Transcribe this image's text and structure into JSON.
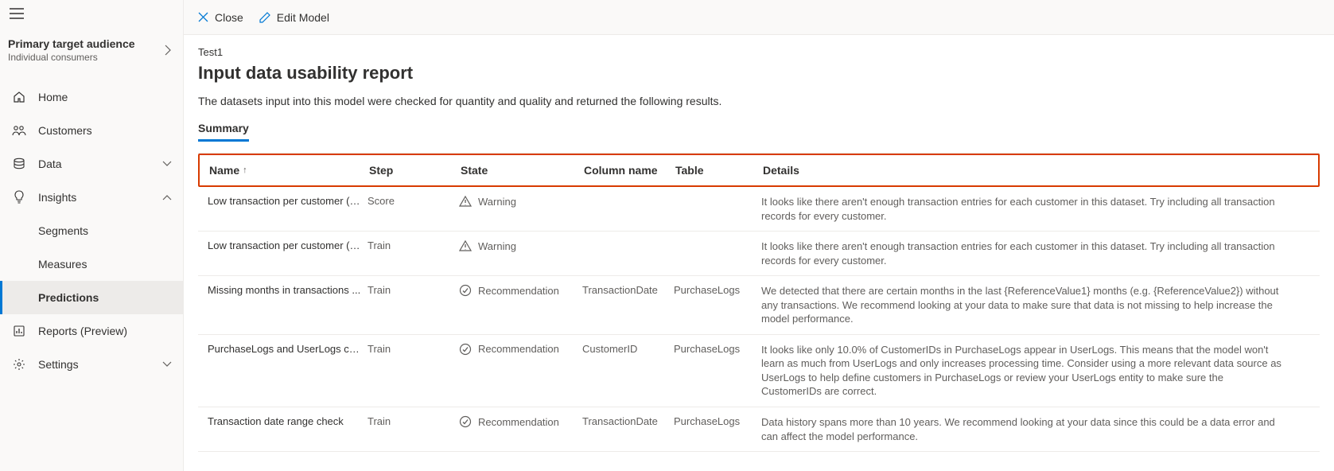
{
  "sidebar": {
    "title": "Primary target audience",
    "subtitle": "Individual consumers",
    "nav": {
      "home": "Home",
      "customers": "Customers",
      "data": "Data",
      "insights": "Insights",
      "segments": "Segments",
      "measures": "Measures",
      "predictions": "Predictions",
      "reports": "Reports (Preview)",
      "settings": "Settings"
    }
  },
  "toolbar": {
    "close": "Close",
    "edit_model": "Edit Model"
  },
  "page": {
    "breadcrumb": "Test1",
    "title": "Input data usability report",
    "description": "The datasets input into this model were checked for quantity and quality and returned the following results.",
    "tab": "Summary"
  },
  "table": {
    "headers": {
      "name": "Name",
      "step": "Step",
      "state": "State",
      "column": "Column name",
      "table": "Table",
      "details": "Details"
    },
    "sort_arrow": "↑",
    "rows": [
      {
        "name": "Low transaction per customer (s...",
        "step": "Score",
        "state": "Warning",
        "state_icon": "warning",
        "column": "",
        "table": "",
        "details": "It looks like there aren't enough transaction entries for each customer in this dataset. Try including all transaction records for every customer."
      },
      {
        "name": "Low transaction per customer (s...",
        "step": "Train",
        "state": "Warning",
        "state_icon": "warning",
        "column": "",
        "table": "",
        "details": "It looks like there aren't enough transaction entries for each customer in this dataset. Try including all transaction records for every customer."
      },
      {
        "name": "Missing months in transactions ...",
        "step": "Train",
        "state": "Recommendation",
        "state_icon": "check",
        "column": "TransactionDate",
        "table": "PurchaseLogs",
        "details": "We detected that there are certain months in the last {ReferenceValue1} months (e.g. {ReferenceValue2}) without any transactions. We recommend looking at your data to make sure that data is not missing to help increase the model performance."
      },
      {
        "name": "PurchaseLogs and UserLogs cus...",
        "step": "Train",
        "state": "Recommendation",
        "state_icon": "check",
        "column": "CustomerID",
        "table": "PurchaseLogs",
        "details": "It looks like only 10.0% of CustomerIDs in PurchaseLogs appear in UserLogs. This means that the model won't learn as much from UserLogs and only increases processing time. Consider using a more relevant data source as UserLogs to help define customers in PurchaseLogs or review your UserLogs entity to make sure the CustomerIDs are correct."
      },
      {
        "name": "Transaction date range check",
        "step": "Train",
        "state": "Recommendation",
        "state_icon": "check",
        "column": "TransactionDate",
        "table": "PurchaseLogs",
        "details": "Data history spans more than 10 years. We recommend looking at your data since this could be a data error and can affect the model performance."
      }
    ]
  }
}
